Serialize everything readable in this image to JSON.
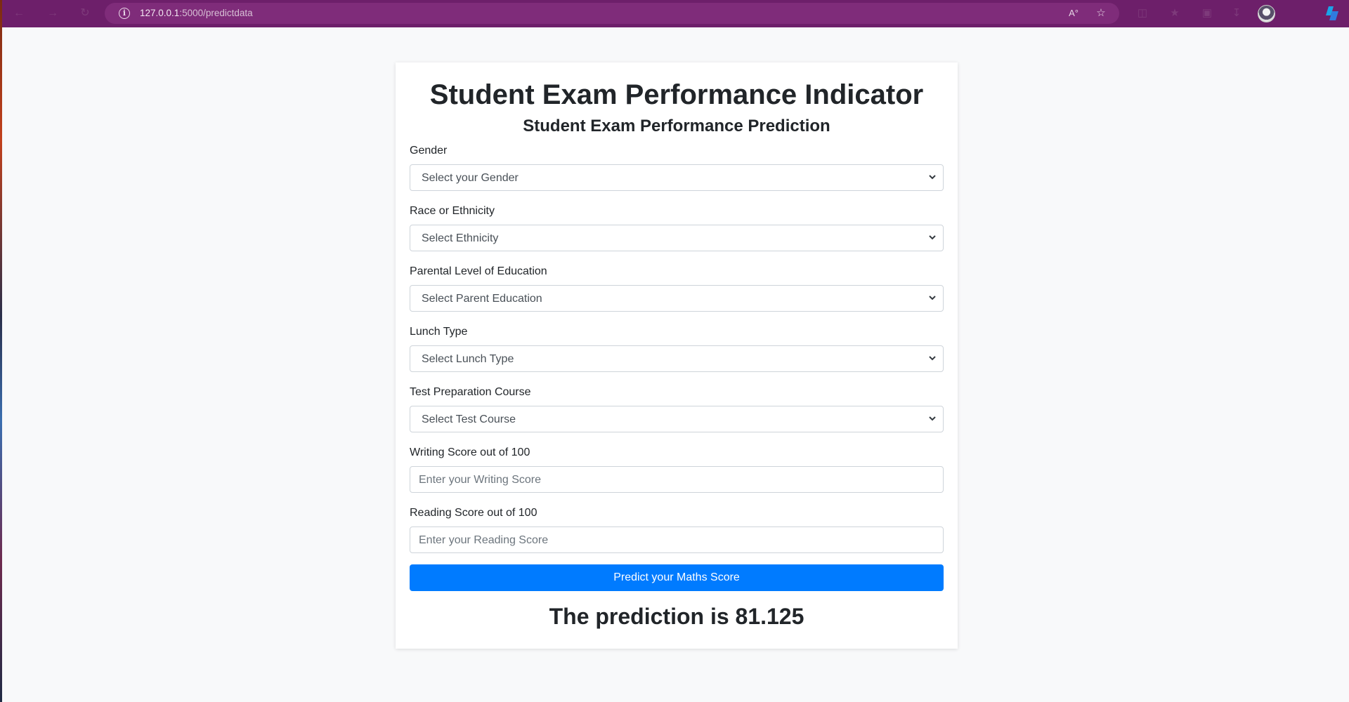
{
  "browser": {
    "url_host": "127.0.0.1",
    "url_path": ":5000/predictdata",
    "read_aloud_label": "A°"
  },
  "page": {
    "title": "Student Exam Performance Indicator",
    "subtitle": "Student Exam Performance Prediction"
  },
  "form": {
    "gender": {
      "label": "Gender",
      "value": "Select your Gender"
    },
    "ethnicity": {
      "label": "Race or Ethnicity",
      "value": "Select Ethnicity"
    },
    "parental_education": {
      "label": "Parental Level of Education",
      "value": "Select Parent Education"
    },
    "lunch": {
      "label": "Lunch Type",
      "value": "Select Lunch Type"
    },
    "test_prep": {
      "label": "Test Preparation Course",
      "value": "Select Test Course"
    },
    "writing_score": {
      "label": "Writing Score out of 100",
      "placeholder": "Enter your Writing Score",
      "value": ""
    },
    "reading_score": {
      "label": "Reading Score out of 100",
      "placeholder": "Enter your Reading Score",
      "value": ""
    },
    "submit_label": "Predict your Maths Score"
  },
  "result": {
    "text": "The prediction is 81.125"
  },
  "colors": {
    "browser_bar": "#6d1f6a",
    "primary_button": "#007bff",
    "page_background": "#f8f9fa"
  }
}
